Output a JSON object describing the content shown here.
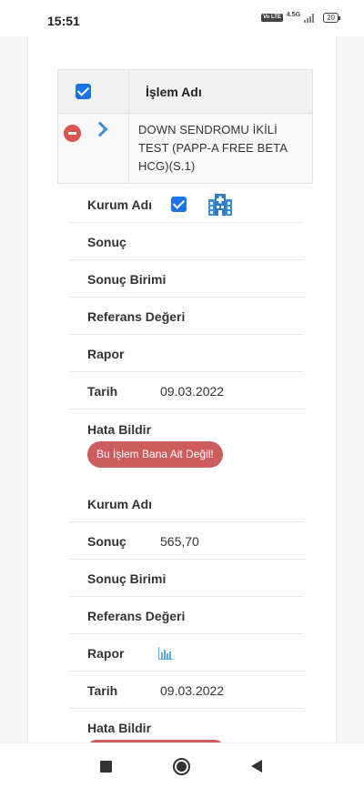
{
  "status_bar": {
    "time": "15:51",
    "volte": "Vo LTE",
    "network": "4.5G",
    "battery": "20"
  },
  "table": {
    "header": {
      "title": "İşlem Adı"
    },
    "rows": [
      {
        "name": "DOWN SENDROMU İKİLİ TEST (PAPP-A FREE BETA HCG)(S.1)"
      }
    ]
  },
  "details": [
    {
      "kurum_label": "Kurum Adı",
      "sonuc_label": "Sonuç",
      "sonuc_value": "",
      "birim_label": "Sonuç Birimi",
      "referans_label": "Referans Değeri",
      "rapor_label": "Rapor",
      "tarih_label": "Tarih",
      "tarih_value": "09.03.2022",
      "hata_label": "Hata Bildir",
      "hata_button": "Bu İşlem Bana Ait Değil!"
    },
    {
      "kurum_label": "Kurum Adı",
      "sonuc_label": "Sonuç",
      "sonuc_value": "565,70",
      "birim_label": "Sonuç Birimi",
      "referans_label": "Referans Değeri",
      "rapor_label": "Rapor",
      "tarih_label": "Tarih",
      "tarih_value": "09.03.2022",
      "hata_label": "Hata Bildir"
    }
  ],
  "icons": {
    "hospital": "hospital-icon",
    "chart": "bar-chart-icon",
    "remove": "minus-circle-icon",
    "expand": "chevron-right-icon"
  },
  "colors": {
    "accent": "#1a73e8",
    "danger": "#cd5c5c",
    "chevron": "#3a8fd6",
    "hospital": "#3b8fd8"
  }
}
